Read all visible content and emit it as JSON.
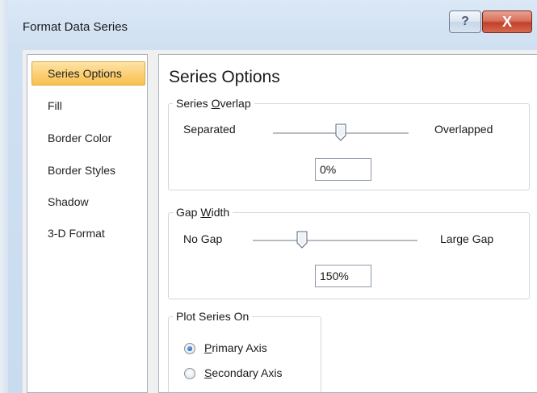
{
  "window": {
    "title": "Format Data Series",
    "help_glyph": "?",
    "close_glyph": "X"
  },
  "nav": {
    "items": [
      {
        "label": "Series Options",
        "selected": true
      },
      {
        "label": "Fill"
      },
      {
        "label": "Border Color"
      },
      {
        "label": "Border Styles"
      },
      {
        "label": "Shadow"
      },
      {
        "label": "3-D Format"
      }
    ]
  },
  "panel": {
    "title": "Series Options",
    "series_overlap": {
      "label_pre": "Series ",
      "label_access": "O",
      "label_post": "verlap",
      "min_label": "Separated",
      "max_label": "Overlapped",
      "value": "0%",
      "slider_fraction": 0.5
    },
    "gap_width": {
      "label_pre": "Gap ",
      "label_access": "W",
      "label_post": "idth",
      "min_label": "No Gap",
      "max_label": "Large Gap",
      "value": "150%",
      "slider_fraction": 0.3
    },
    "plot_series_on": {
      "label": "Plot Series On",
      "options": [
        {
          "access": "P",
          "rest": "rimary Axis",
          "checked": true
        },
        {
          "access": "S",
          "rest": "econdary Axis",
          "checked": false
        }
      ]
    }
  }
}
